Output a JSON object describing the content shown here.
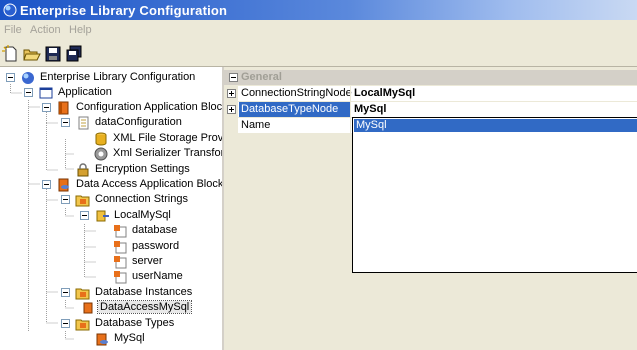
{
  "window": {
    "title": "Enterprise Library Configuration"
  },
  "menu": [
    "File",
    "Action",
    "Help"
  ],
  "toolbar": {
    "icons": [
      "new-icon",
      "open-icon",
      "save-icon",
      "save-all-icon"
    ]
  },
  "tree": {
    "items": [
      {
        "label": "Enterprise Library Configuration"
      },
      {
        "label": "Application"
      },
      {
        "label": "Configuration Application Block"
      },
      {
        "label": "dataConfiguration"
      },
      {
        "label": "XML File Storage Provid"
      },
      {
        "label": "Xml Serializer Transform"
      },
      {
        "label": "Encryption Settings"
      },
      {
        "label": "Data Access Application Block"
      },
      {
        "label": "Connection Strings"
      },
      {
        "label": "LocalMySql"
      },
      {
        "label": "database"
      },
      {
        "label": "password"
      },
      {
        "label": "server"
      },
      {
        "label": "userName"
      },
      {
        "label": "Database Instances"
      },
      {
        "label": "DataAccessMySql"
      },
      {
        "label": "Database Types"
      },
      {
        "label": "MySql"
      }
    ]
  },
  "properties": {
    "category": "General",
    "rows": [
      {
        "name": "ConnectionStringNode",
        "value": "LocalMySql"
      },
      {
        "name": "DatabaseTypeNode",
        "value": "MySql"
      },
      {
        "name": "Name",
        "value": ""
      }
    ],
    "dropdown_options": [
      "MySql"
    ]
  },
  "colors": {
    "selection": "#316ac5",
    "titlebar": "#1a53c7"
  }
}
